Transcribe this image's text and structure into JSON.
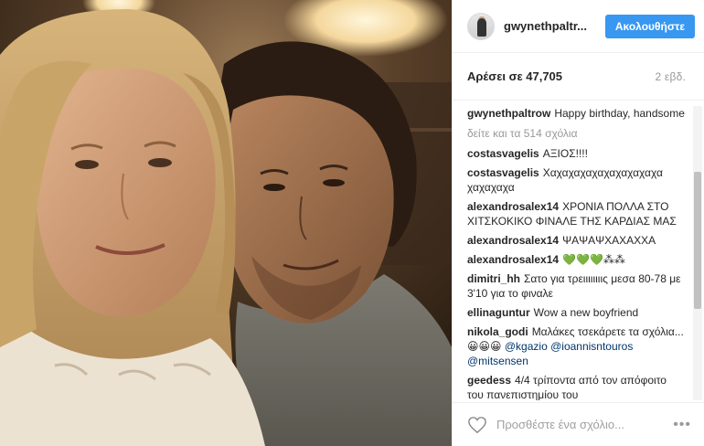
{
  "photo": {
    "description_icon": "selfie-photo"
  },
  "header": {
    "username": "gwynethpaltr...",
    "follow_label": "Ακολουθήστε",
    "avatar_icon": "profile-avatar"
  },
  "stats": {
    "likes": "Αρέσει σε 47,705",
    "time": "2 εβδ."
  },
  "caption": {
    "user": "gwynethpaltrow",
    "text": "Happy birthday, handsome"
  },
  "load_more": "δείτε και τα 514 σχόλια",
  "comments": [
    {
      "user": "costasvagelis",
      "text": "ΑΞΙΟΣ!!!!"
    },
    {
      "user": "costasvagelis",
      "text": "Χαχαχαχαχαχαχαχαχαχα χαχαχαχα"
    },
    {
      "user": "alexandrosalex14",
      "text": "ΧΡΟΝΙΑ ΠΟΛΛΑ ΣΤΟ ΧΙΤΣΚΟΚΙΚΟ ΦΙΝΑΛΕ ΤΗΣ ΚΑΡΔΙΑΣ ΜΑΣ"
    },
    {
      "user": "alexandrosalex14",
      "text": "ΨΑΨΑΨΧΑΧΑΧΧΑ"
    },
    {
      "user": "alexandrosalex14",
      "text": "💚💚💚⁂⁂"
    },
    {
      "user": "dimitri_hh",
      "text": "Σατο για τρειιιιιιιις μεσα 80-78 με 3'10 για το φιναλε"
    },
    {
      "user": "ellinaguntur",
      "text": "Wow a new boyfriend"
    },
    {
      "user": "nikola_godi",
      "text": "Μαλάκες τσεκάρετε τα σχόλια... 😀😀😀",
      "mentions": [
        "@kgazio",
        "@ioannisntouros",
        "@mitsensen"
      ]
    },
    {
      "user": "geedess",
      "text": "4/4 τρίποντα από τον απόφοιτο του πανεπιστημίου του"
    }
  ],
  "scroll": {
    "position": 0.42
  },
  "footer": {
    "placeholder": "Προσθέστε ένα σχόλιο...",
    "more_label": "•••"
  },
  "colors": {
    "accent": "#3897f0",
    "muted": "#999999",
    "mention": "#003569"
  }
}
